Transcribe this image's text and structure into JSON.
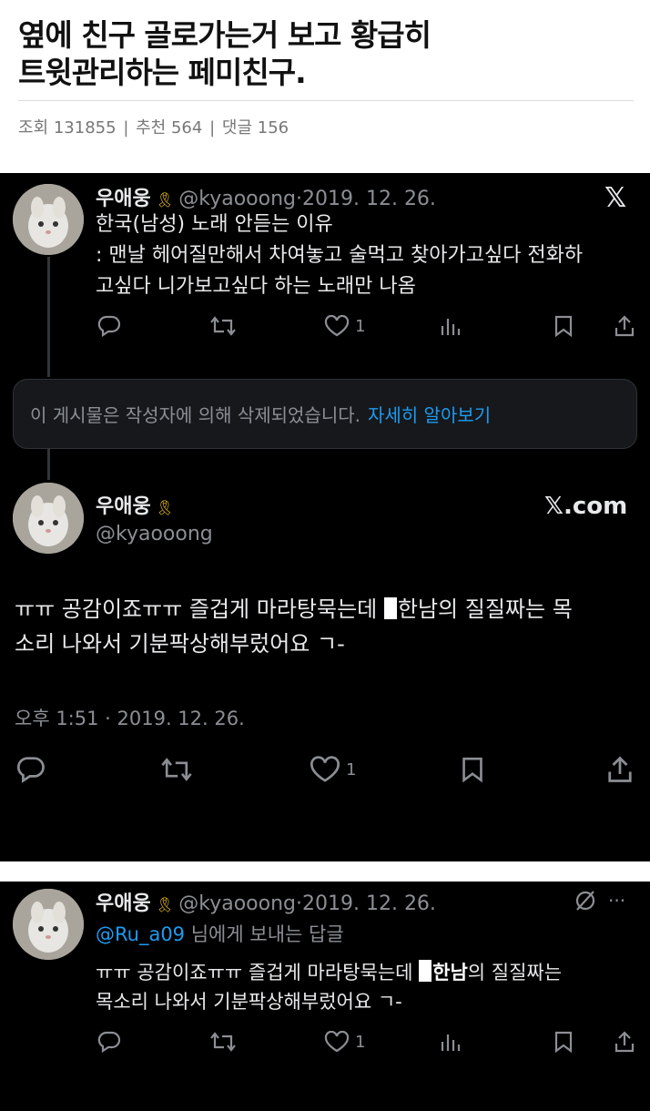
{
  "post": {
    "title_line1": "옆에 친구 골로가는거 보고 황급히",
    "title_line2": "트윗관리하는 페미친구.",
    "views_label": "조회",
    "views": "131855",
    "recommend_label": "추천",
    "recommend": "564",
    "comments_label": "댓글",
    "comments": "156",
    "sep": "|"
  },
  "tweet1": {
    "name": "우애웅",
    "ribbon": "🎗",
    "handle": "@kyaooong",
    "dot": "·",
    "date": "2019. 12. 26.",
    "line1": "한국(남성) 노래 안듣는 이유",
    "line2": ": 맨날 헤어질만해서 차여놓고 술먹고 찾아가고싶다 전화하",
    "line3": "고싶다 니가보고싶다 하는 노래만 나옴",
    "likes": "1",
    "x_logo": "𝕏"
  },
  "deleted_notice": {
    "text": "이 게시물은 작성자에 의해 삭제되었습니다.",
    "link": "자세히 알아보기"
  },
  "tweet2": {
    "name": "우애웅",
    "ribbon": "🎗",
    "handle": "@kyaooong",
    "site": "𝕏.com",
    "text_a": "ㅠㅠ 공감이죠ㅠㅠ 즐겁게 마라탕묵는데 ",
    "text_b": "한남의 질질짜는 목",
    "text_c": "소리 나와서 기분팍상해부렀어요 ㄱ-",
    "time": "오후 1:51 · 2019. 12. 26.",
    "likes": "1"
  },
  "tweet3": {
    "name": "우애웅",
    "ribbon": "🎗",
    "handle": "@kyaooong",
    "dot": "·",
    "date": "2019. 12. 26.",
    "reply_handle": "@Ru_a09",
    "reply_suffix": " 님에게 보내는 답글",
    "text_a": "ㅠㅠ 공감이죠ㅠㅠ 즐겁게 마라탕묵는데 ",
    "text_b": "한남",
    "text_c": "의 질질짜는",
    "text_d": "목소리 나와서 기분팍상해부렀어요 ㄱ-",
    "likes": "1",
    "more": "···"
  },
  "icons": [
    "reply-icon",
    "retweet-icon",
    "like-icon",
    "views-icon",
    "bookmark-icon",
    "share-icon",
    "x-logo-icon",
    "grok-icon",
    "more-icon"
  ],
  "colors": {
    "background": "#000000",
    "text": "#e7e9ea",
    "muted": "#8b8f94",
    "link": "#1d9bf0",
    "ribbon": "#f2c21b"
  }
}
